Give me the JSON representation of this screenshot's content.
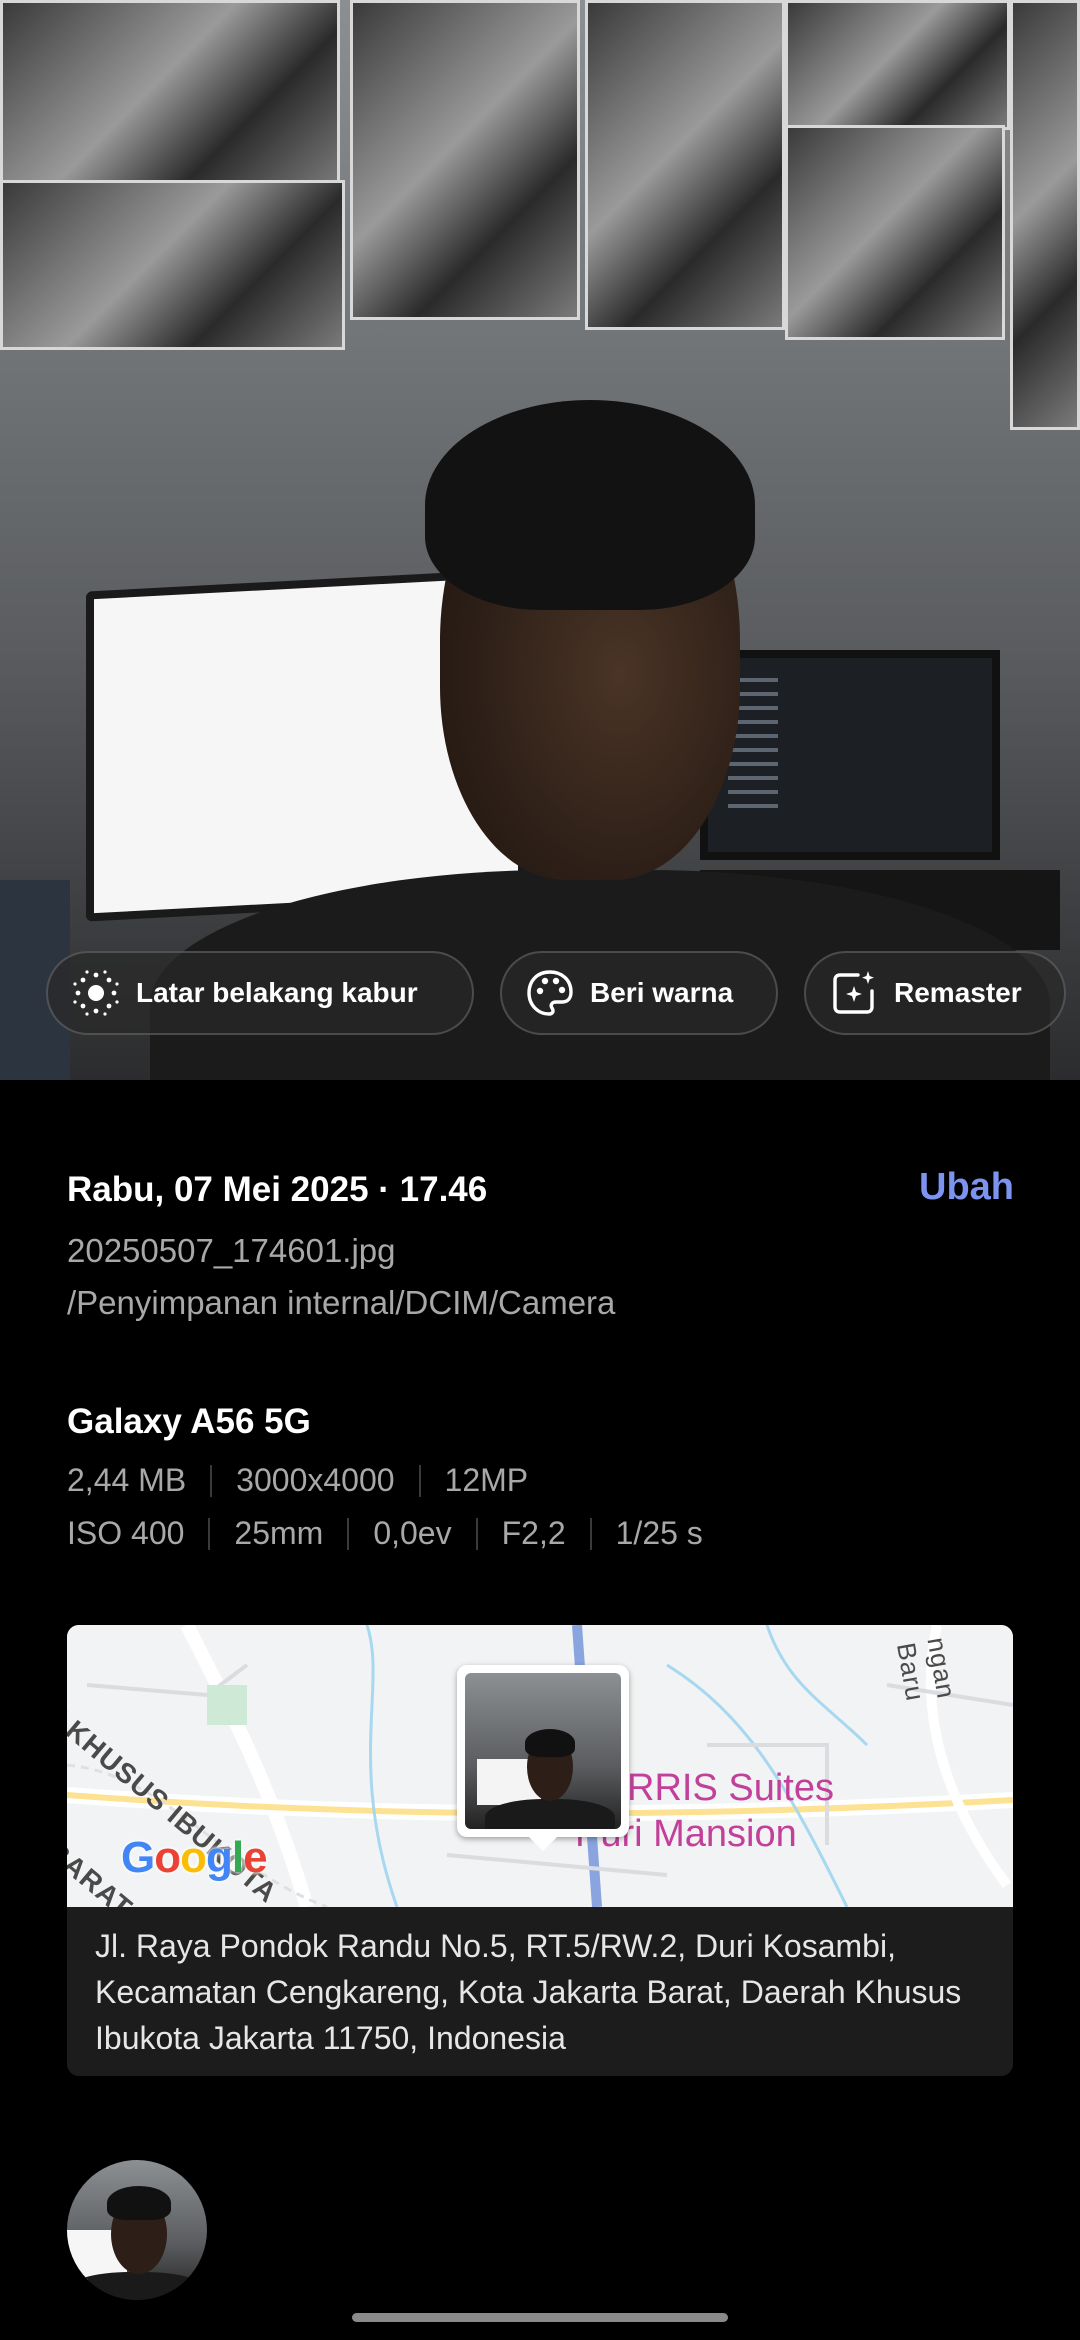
{
  "suggestions": {
    "blur_label": "Latar belakang kabur",
    "color_label": "Beri warna",
    "remaster_label": "Remaster"
  },
  "details": {
    "datetime": "Rabu, 07 Mei 2025 · 17.46",
    "edit_label": "Ubah",
    "filename": "20250507_174601.jpg",
    "path": "/Penyimpanan internal/DCIM/Camera",
    "device": "Galaxy A56 5G",
    "size": "2,44 MB",
    "resolution": "3000x4000",
    "megapixels": "12MP",
    "iso": "ISO 400",
    "focal_length": "25mm",
    "exposure_value": "0,0ev",
    "aperture": "F2,2",
    "shutter": "1/25 s"
  },
  "map": {
    "road_label_1": "H KHUSUS IBUKOTA",
    "road_label_2": "BARAT EN",
    "road_label_3": "ngan Baru",
    "poi_line_1": "RRIS Suites",
    "poi_line_2": "Puri Mansion",
    "google_logo": "Google",
    "address": "Jl. Raya Pondok Randu No.5, RT.5/RW.2, Duri Kosambi, Kecamatan Cengkareng, Kota Jakarta Barat, Daerah Khusus Ibukota Jakarta 11750, Indonesia"
  },
  "colors": {
    "accent": "#7c93f0",
    "poi": "#c2409a",
    "background": "#000000"
  },
  "icons": {
    "blur": "background-blur-icon",
    "color": "palette-icon",
    "remaster": "sparkle-image-icon"
  }
}
